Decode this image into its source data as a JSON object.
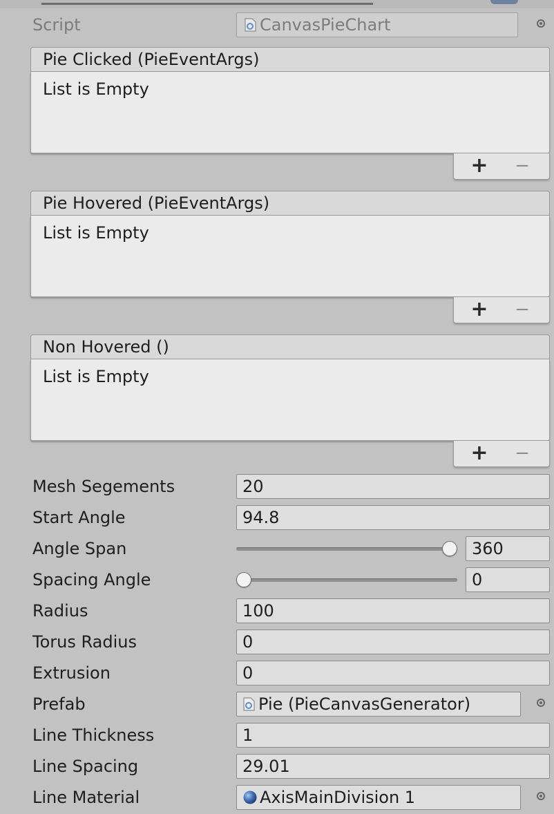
{
  "script": {
    "label": "Script",
    "value": "CanvasPieChart"
  },
  "events": [
    {
      "title": "Pie Clicked (PieEventArgs)",
      "empty_text": "List is Empty",
      "add": "+",
      "remove": "−"
    },
    {
      "title": "Pie Hovered (PieEventArgs)",
      "empty_text": "List is Empty",
      "add": "+",
      "remove": "−"
    },
    {
      "title": "Non Hovered ()",
      "empty_text": "List is Empty",
      "add": "+",
      "remove": "−"
    }
  ],
  "fields": {
    "mesh_segments": {
      "label": "Mesh Segements",
      "value": "20"
    },
    "start_angle": {
      "label": "Start Angle",
      "value": "94.8"
    },
    "angle_span": {
      "label": "Angle Span",
      "value": "360",
      "slider_fraction": 1.0
    },
    "spacing_angle": {
      "label": "Spacing Angle",
      "value": "0",
      "slider_fraction": 0.0
    },
    "radius": {
      "label": "Radius",
      "value": "100"
    },
    "torus_radius": {
      "label": "Torus Radius",
      "value": "0"
    },
    "extrusion": {
      "label": "Extrusion",
      "value": "0"
    },
    "prefab": {
      "label": "Prefab",
      "value": "Pie (PieCanvasGenerator)"
    },
    "line_thickness": {
      "label": "Line Thickness",
      "value": "1"
    },
    "line_spacing": {
      "label": "Line Spacing",
      "value": "29.01"
    },
    "line_material": {
      "label": "Line Material",
      "value": "AxisMainDivision 1"
    }
  },
  "icons": {
    "script": "script-file-icon",
    "prefab": "script-file-icon",
    "material": "material-sphere-icon",
    "picker": "object-picker-icon"
  },
  "colors": {
    "background": "#c2c2c2",
    "field": "#dedede",
    "panel": "#ebebeb",
    "material_blue": "#3f6fb5"
  }
}
